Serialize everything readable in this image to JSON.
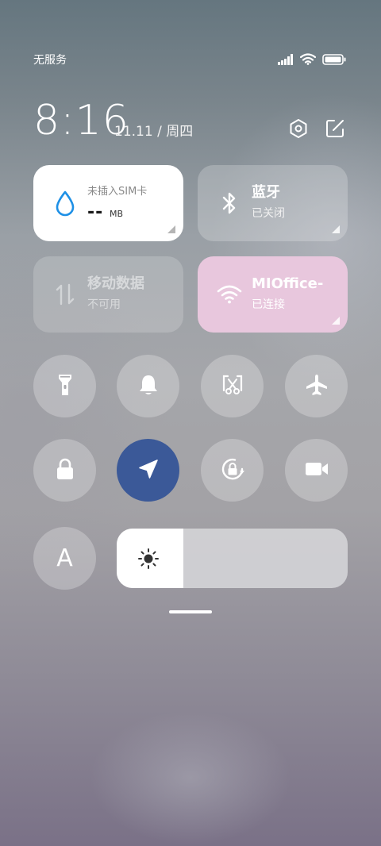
{
  "status_bar": {
    "carrier": "无服务",
    "icons": [
      "signal-icon",
      "wifi-icon",
      "battery-icon"
    ],
    "battery_level": 1.0
  },
  "header": {
    "time": "8:16",
    "date": "11.11 / 周四",
    "buttons": [
      "settings-icon",
      "edit-icon"
    ]
  },
  "tiles": {
    "data_usage": {
      "title": "未插入SIM卡",
      "value": "--",
      "unit": "MB",
      "icon": "water-drop-icon"
    },
    "bluetooth": {
      "title": "蓝牙",
      "status": "已关闭",
      "icon": "bluetooth-icon"
    },
    "mobile_data": {
      "title": "移动数据",
      "status": "不可用",
      "icon": "data-arrows-icon"
    },
    "wifi": {
      "title": "MIOffice-",
      "status": "已连接",
      "icon": "wifi-icon"
    }
  },
  "toggles_row1": [
    "flashlight-icon",
    "bell-icon",
    "screenshot-icon",
    "airplane-icon"
  ],
  "toggles_row2": [
    "lock-icon",
    "location-icon",
    "rotation-lock-icon",
    "video-camera-icon"
  ],
  "active_toggle": "location-icon",
  "brightness": {
    "auto_label": "A",
    "level": 0.29,
    "icon": "brightness-icon"
  },
  "colors": {
    "active_toggle": "#3b5998",
    "wifi_tile": "#e8c7dd",
    "data_icon": "#1e90e6"
  }
}
